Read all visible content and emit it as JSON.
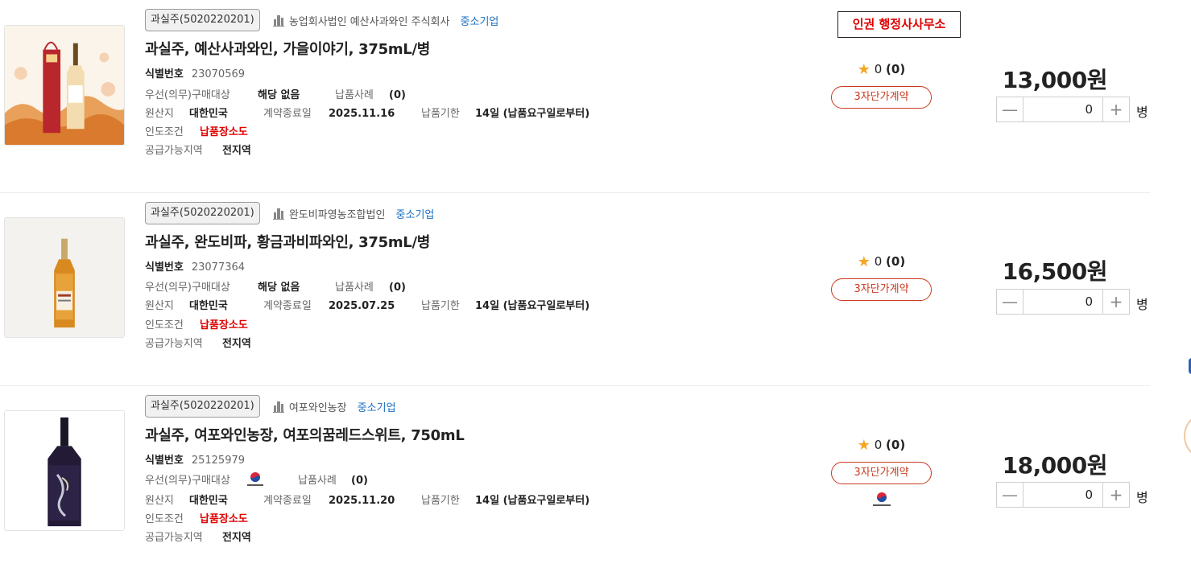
{
  "notice": "인권 행정사사무소",
  "labels": {
    "id": "식별번호",
    "priority": "우선(의무)구매대상",
    "cases": "납품사례",
    "origin": "원산지",
    "contract_end": "계약종료일",
    "deadline": "납품기한",
    "delivery": "인도조건",
    "region": "공급가능지역"
  },
  "products": [
    {
      "category": "과실주(5020220201)",
      "company": "농업회사법인 예산사과와인 주식회사",
      "sme": "중소기업",
      "title": "과실주, 예산사과와인, 가을이야기, 375mL/병",
      "id": "23070569",
      "priority_value": "해당 없음",
      "cases": "(0)",
      "origin": "대한민국",
      "contract_end": "2025.11.16",
      "deadline": "14일 (납품요구일로부터)",
      "delivery": "납품장소도",
      "region": "전지역",
      "rating": "0",
      "rating_count": "(0)",
      "contract_type": "3자단가계약",
      "price": "13,000원",
      "qty": "0",
      "unit": "병"
    },
    {
      "category": "과실주(5020220201)",
      "company": "완도비파영농조합법인",
      "sme": "중소기업",
      "title": "과실주, 완도비파, 황금과비파와인, 375mL/병",
      "id": "23077364",
      "priority_value": "해당 없음",
      "cases": "(0)",
      "origin": "대한민국",
      "contract_end": "2025.07.25",
      "deadline": "14일 (납품요구일로부터)",
      "delivery": "납품장소도",
      "region": "전지역",
      "rating": "0",
      "rating_count": "(0)",
      "contract_type": "3자단가계약",
      "price": "16,500원",
      "qty": "0",
      "unit": "병"
    },
    {
      "category": "과실주(5020220201)",
      "company": "여포와인농장",
      "sme": "중소기업",
      "title": "과실주, 여포와인농장, 여포의꿈레드스위트, 750mL",
      "id": "25125979",
      "priority_value": "",
      "cases": "(0)",
      "origin": "대한민국",
      "contract_end": "2025.11.20",
      "deadline": "14일 (납품요구일로부터)",
      "delivery": "납품장소도",
      "region": "전지역",
      "rating": "0",
      "rating_count": "(0)",
      "contract_type": "3자단가계약",
      "price": "18,000원",
      "qty": "0",
      "unit": "병"
    }
  ],
  "icons": {
    "company": "building-icon",
    "star": "star-icon",
    "priority_mark": "korea-seal-icon",
    "minus": "minus-icon",
    "plus": "plus-icon"
  },
  "colors": {
    "sme_blue": "#1a6fc2",
    "red": "#e00000",
    "contract": "#c93a1e",
    "star": "#f5a623"
  }
}
